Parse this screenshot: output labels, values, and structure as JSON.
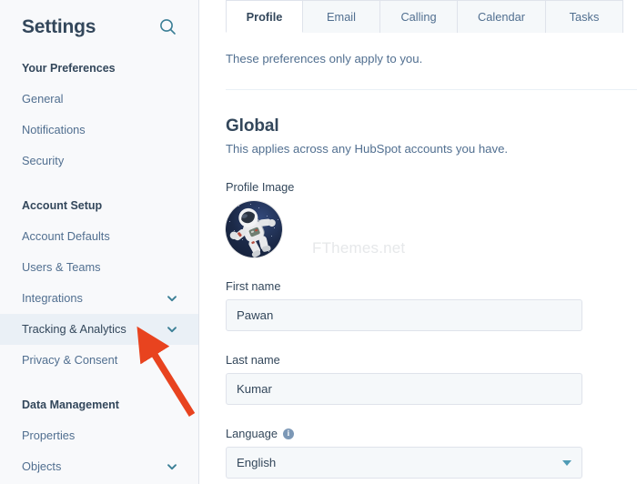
{
  "sidebar": {
    "title": "Settings",
    "search_icon": "search-icon",
    "groups": [
      {
        "label": "Your Preferences",
        "items": [
          {
            "label": "General",
            "expandable": false,
            "active": false
          },
          {
            "label": "Notifications",
            "expandable": false,
            "active": false
          },
          {
            "label": "Security",
            "expandable": false,
            "active": false
          }
        ]
      },
      {
        "label": "Account Setup",
        "items": [
          {
            "label": "Account Defaults",
            "expandable": false,
            "active": false
          },
          {
            "label": "Users & Teams",
            "expandable": false,
            "active": false
          },
          {
            "label": "Integrations",
            "expandable": true,
            "active": false
          },
          {
            "label": "Tracking & Analytics",
            "expandable": true,
            "active": true
          },
          {
            "label": "Privacy & Consent",
            "expandable": false,
            "active": false
          }
        ]
      },
      {
        "label": "Data Management",
        "items": [
          {
            "label": "Properties",
            "expandable": false,
            "active": false
          },
          {
            "label": "Objects",
            "expandable": true,
            "active": false
          }
        ]
      }
    ]
  },
  "main": {
    "tabs": [
      {
        "label": "Profile",
        "active": true
      },
      {
        "label": "Email",
        "active": false
      },
      {
        "label": "Calling",
        "active": false
      },
      {
        "label": "Calendar",
        "active": false
      },
      {
        "label": "Tasks",
        "active": false
      }
    ],
    "intro": "These preferences only apply to you.",
    "section": {
      "title": "Global",
      "subtitle": "This applies across any HubSpot accounts you have."
    },
    "profile_image_label": "Profile Image",
    "watermark": "FThemes.net",
    "fields": [
      {
        "label": "First name",
        "value": "Pawan",
        "type": "text"
      },
      {
        "label": "Last name",
        "value": "Kumar",
        "type": "text"
      }
    ],
    "language": {
      "label": "Language",
      "value": "English",
      "info_glyph": "i"
    }
  },
  "annotation": {
    "arrow_color": "#E8431F"
  },
  "colors": {
    "accent": "#4f9bb5",
    "text_dark": "#33475b",
    "text_muted": "#516f90",
    "border": "#dfe3eb",
    "sidebar_bg": "#f8f9fb",
    "active_row": "#eaf0f6",
    "input_bg": "#f5f8fa"
  }
}
